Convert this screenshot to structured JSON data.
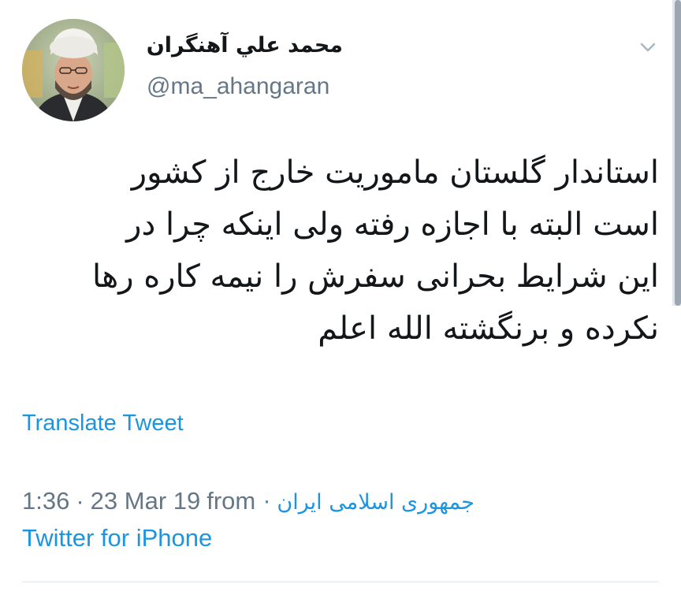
{
  "tweet": {
    "display_name": "محمد علي آهنگران",
    "handle": "@ma_ahangaran",
    "text_lines": [
      "استاندار گلستان ماموریت خارج از کشور",
      "است البته با اجازه رفته ولی اینکه چرا در",
      "این شرایط بحرانی سفرش را نیمه کاره رها",
      "نکرده و برنگشته الله اعلم"
    ],
    "translate_label": "Translate Tweet",
    "time": "1:36",
    "separator": "·",
    "date": "23 Mar 19",
    "from_word": "from",
    "location": "جمهوری اسلامی ایران ·",
    "source": "Twitter for iPhone"
  },
  "icons": {
    "menu": "chevron-down-icon",
    "avatar": "profile-photo"
  },
  "colors": {
    "link": "#1b95e0",
    "secondary": "#657786",
    "text": "#14171a"
  }
}
